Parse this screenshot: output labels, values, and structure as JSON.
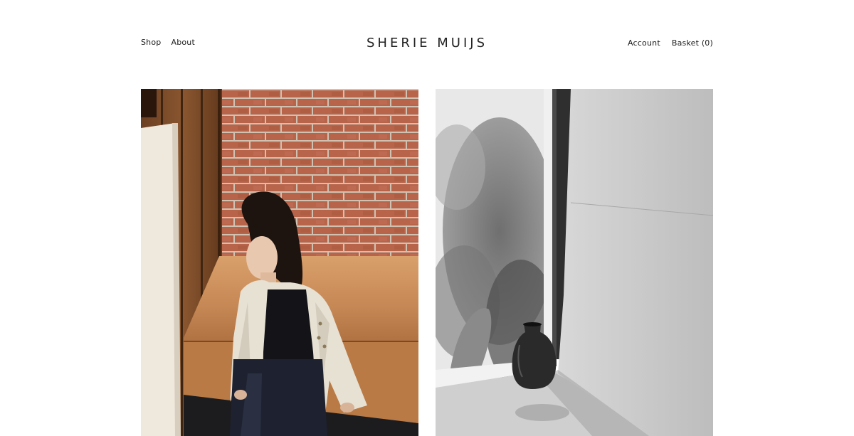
{
  "header": {
    "brand": "SHERIE MUIJS",
    "nav_left": [
      {
        "label": "Shop"
      },
      {
        "label": "About"
      }
    ],
    "nav_right": {
      "account_label": "Account",
      "basket_label": "Basket (0)"
    }
  },
  "gallery": {
    "items": [
      {
        "subject": "model-in-linen-jacket"
      },
      {
        "subject": "vase-by-window-bw"
      }
    ]
  }
}
